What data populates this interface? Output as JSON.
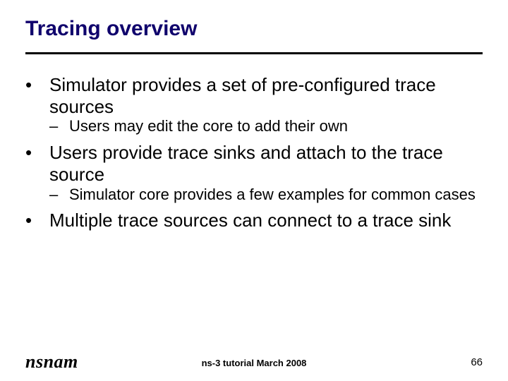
{
  "title": "Tracing overview",
  "bullets": {
    "b0": "Simulator provides a set of pre-configured trace sources",
    "b0s0": "Users may edit the core to add their own",
    "b1": "Users provide trace sinks and attach to the trace source",
    "b1s0": "Simulator core provides a few examples for common cases",
    "b2": "Multiple trace sources can connect to a trace sink"
  },
  "footer": {
    "center": "ns-3 tutorial March 2008",
    "pagenum": "66",
    "logo": "nsnam"
  }
}
